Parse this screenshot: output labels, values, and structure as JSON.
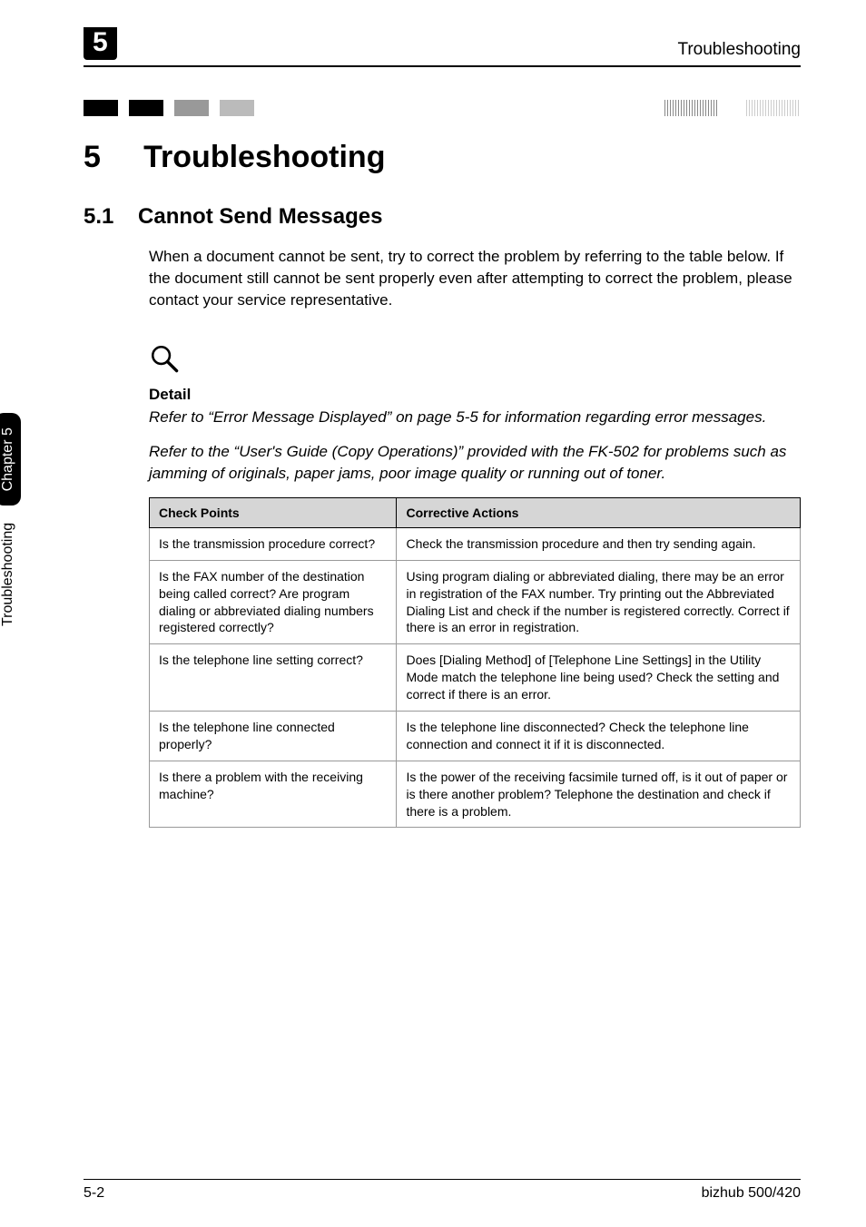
{
  "running_head": {
    "chapter_num": "5",
    "title": "Troubleshooting"
  },
  "heading": {
    "number": "5",
    "text": "Troubleshooting"
  },
  "subheading": {
    "number": "5.1",
    "text": "Cannot Send Messages"
  },
  "intro_paragraph": "When a document cannot be sent, try to correct the problem by referring to the table below. If the document still cannot be sent properly even after attempting to correct the problem, please contact your service representative.",
  "detail": {
    "label": "Detail",
    "para1": "Refer to “Error Message Displayed” on page 5-5 for information regarding error messages.",
    "para2": "Refer to the “User's Guide (Copy Operations)” provided with the FK-502 for problems such as jamming of originals, paper jams, poor image quality or running out of toner."
  },
  "table": {
    "headers": [
      "Check Points",
      "Corrective Actions"
    ],
    "rows": [
      {
        "check": "Is the transmission procedure correct?",
        "action": "Check the transmission procedure and then try sending again."
      },
      {
        "check": "Is the FAX number of the destination being called correct? Are program dialing or abbreviated dialing numbers registered correctly?",
        "action": "Using program dialing or abbreviated dialing, there may be an error in registration of the FAX number. Try printing out the Abbreviated Dialing List and check if the number is registered correctly. Correct if there is an error in registration."
      },
      {
        "check": "Is the telephone line setting correct?",
        "action": "Does [Dialing Method] of [Telephone Line Settings] in the Utility Mode match the telephone line being used? Check the setting and correct if there is an error."
      },
      {
        "check": "Is the telephone line connected properly?",
        "action": "Is the telephone line disconnected? Check the telephone line connection and connect it if it is disconnected."
      },
      {
        "check": "Is there a problem with the receiving machine?",
        "action": "Is the power of the receiving facsimile turned off, is it out of paper or is there another problem? Telephone the destination and check if there is a problem."
      }
    ]
  },
  "side_tab": {
    "section": "Troubleshooting",
    "chapter": "Chapter 5"
  },
  "footer": {
    "page": "5-2",
    "product": "bizhub 500/420"
  }
}
